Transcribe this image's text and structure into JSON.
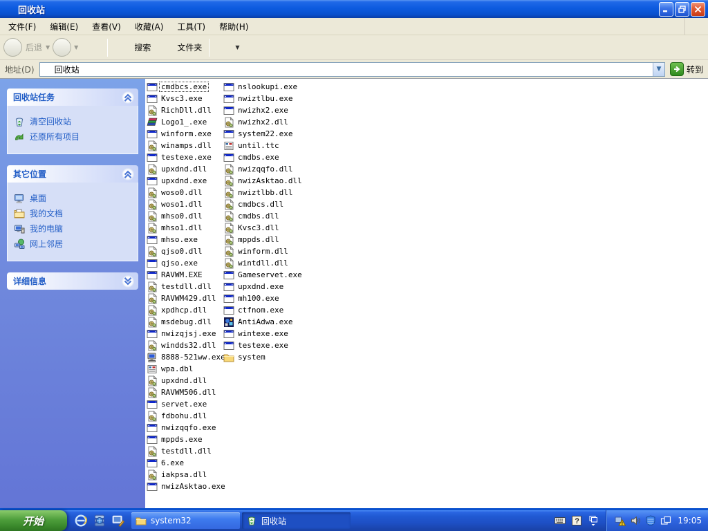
{
  "window": {
    "title": "回收站"
  },
  "menu": {
    "items": [
      "文件(F)",
      "编辑(E)",
      "查看(V)",
      "收藏(A)",
      "工具(T)",
      "帮助(H)"
    ]
  },
  "toolbar": {
    "back_label": "后退",
    "search_label": "搜索",
    "folders_label": "文件夹"
  },
  "addressbar": {
    "label": "地址(D)",
    "value": "回收站",
    "go_label": "转到"
  },
  "sidebar": {
    "panels": [
      {
        "title": "回收站任务",
        "collapsed": false,
        "items": [
          {
            "icon": "recycle-empty",
            "label": "清空回收站"
          },
          {
            "icon": "restore-arrow",
            "label": "还原所有项目"
          }
        ]
      },
      {
        "title": "其它位置",
        "collapsed": false,
        "items": [
          {
            "icon": "desktop",
            "label": "桌面"
          },
          {
            "icon": "mydocs",
            "label": "我的文档"
          },
          {
            "icon": "mycomputer",
            "label": "我的电脑"
          },
          {
            "icon": "network",
            "label": "网上邻居"
          }
        ]
      },
      {
        "title": "详细信息",
        "collapsed": true,
        "items": []
      }
    ]
  },
  "filelist": {
    "columns": [
      {
        "items": [
          {
            "icon": "exe",
            "name": "cmdbcs.exe",
            "selected": true
          },
          {
            "icon": "exe",
            "name": "Kvsc3.exe"
          },
          {
            "icon": "dll",
            "name": "RichDll.dll"
          },
          {
            "icon": "books",
            "name": "Logo1_.exe"
          },
          {
            "icon": "exe",
            "name": "winform.exe"
          },
          {
            "icon": "dll",
            "name": "winamps.dll"
          },
          {
            "icon": "exe",
            "name": "testexe.exe"
          },
          {
            "icon": "dll",
            "name": "upxdnd.dll"
          },
          {
            "icon": "exe",
            "name": "upxdnd.exe"
          },
          {
            "icon": "dll",
            "name": "woso0.dll"
          },
          {
            "icon": "dll",
            "name": "woso1.dll"
          },
          {
            "icon": "dll",
            "name": "mhso0.dll"
          },
          {
            "icon": "dll",
            "name": "mhso1.dll"
          },
          {
            "icon": "exe",
            "name": "mhso.exe"
          },
          {
            "icon": "dll",
            "name": "qjso0.dll"
          },
          {
            "icon": "exe",
            "name": "qjso.exe"
          },
          {
            "icon": "exe",
            "name": "RAVWM.EXE"
          },
          {
            "icon": "dll",
            "name": "testdll.dll"
          },
          {
            "icon": "dll",
            "name": "RAVWM429.dll"
          },
          {
            "icon": "dll",
            "name": "xpdhcp.dll"
          },
          {
            "icon": "dll",
            "name": "msdebug.dll"
          },
          {
            "icon": "exe",
            "name": "nwizqjsj.exe"
          },
          {
            "icon": "dll",
            "name": "windds32.dll"
          },
          {
            "icon": "computer",
            "name": "8888-521ww.exe"
          },
          {
            "icon": "sys",
            "name": "wpa.dbl"
          },
          {
            "icon": "dll",
            "name": "upxdnd.dll"
          },
          {
            "icon": "dll",
            "name": "RAVWM506.dll"
          },
          {
            "icon": "exe",
            "name": "servet.exe"
          },
          {
            "icon": "dll",
            "name": "fdbohu.dll"
          },
          {
            "icon": "exe",
            "name": "nwizqqfo.exe"
          },
          {
            "icon": "exe",
            "name": "mppds.exe"
          },
          {
            "icon": "dll",
            "name": "testdll.dll"
          },
          {
            "icon": "exe",
            "name": "6.exe"
          },
          {
            "icon": "dll",
            "name": "iakpsa.dll"
          },
          {
            "icon": "exe",
            "name": "nwizAsktao.exe"
          }
        ]
      },
      {
        "items": [
          {
            "icon": "exe",
            "name": "nslookupi.exe"
          },
          {
            "icon": "exe",
            "name": "nwiztlbu.exe"
          },
          {
            "icon": "exe",
            "name": "nwizhx2.exe"
          },
          {
            "icon": "dll",
            "name": "nwizhx2.dll"
          },
          {
            "icon": "exe",
            "name": "system22.exe"
          },
          {
            "icon": "sys",
            "name": "until.ttc"
          },
          {
            "icon": "exe",
            "name": "cmdbs.exe"
          },
          {
            "icon": "dll",
            "name": "nwizqqfo.dll"
          },
          {
            "icon": "dll",
            "name": "nwizAsktao.dll"
          },
          {
            "icon": "dll",
            "name": "nwiztlbb.dll"
          },
          {
            "icon": "dll",
            "name": "cmdbcs.dll"
          },
          {
            "icon": "dll",
            "name": "cmdbs.dll"
          },
          {
            "icon": "dll",
            "name": "Kvsc3.dll"
          },
          {
            "icon": "dll",
            "name": "mppds.dll"
          },
          {
            "icon": "dll",
            "name": "winform.dll"
          },
          {
            "icon": "dll",
            "name": "wintdll.dll"
          },
          {
            "icon": "exe",
            "name": "Gameservet.exe"
          },
          {
            "icon": "exe",
            "name": "upxdnd.exe"
          },
          {
            "icon": "exe",
            "name": "mh100.exe"
          },
          {
            "icon": "exe",
            "name": "ctfnom.exe"
          },
          {
            "icon": "antiadwa",
            "name": "AntiAdwa.exe"
          },
          {
            "icon": "exe",
            "name": "wintexe.exe"
          },
          {
            "icon": "exe",
            "name": "testexe.exe"
          },
          {
            "icon": "folder",
            "name": "system"
          }
        ]
      }
    ]
  },
  "taskbar": {
    "start_label": "开始",
    "quick_launch": [
      "ie",
      "globe-stack",
      "show-desktop"
    ],
    "buttons": [
      {
        "icon": "folder",
        "label": "system32",
        "active": false
      },
      {
        "icon": "recycle-bin",
        "label": "回收站",
        "active": true
      }
    ],
    "lang_icons": [
      "keyboard",
      "help",
      "langbar-options"
    ],
    "tray_icons": [
      "tray-warning",
      "tray-speaker",
      "tray-shield",
      "tray-windows"
    ],
    "clock": "19:05"
  },
  "colors": {
    "titlebar_blue": "#0D5BDF",
    "sidebar_blue": "#6F85DB",
    "panel_body": "#D6DFF7",
    "link_blue": "#215DC6",
    "taskbar_blue": "#1E50C5",
    "start_green": "#3B8A2C",
    "go_green": "#2E8A1E"
  }
}
